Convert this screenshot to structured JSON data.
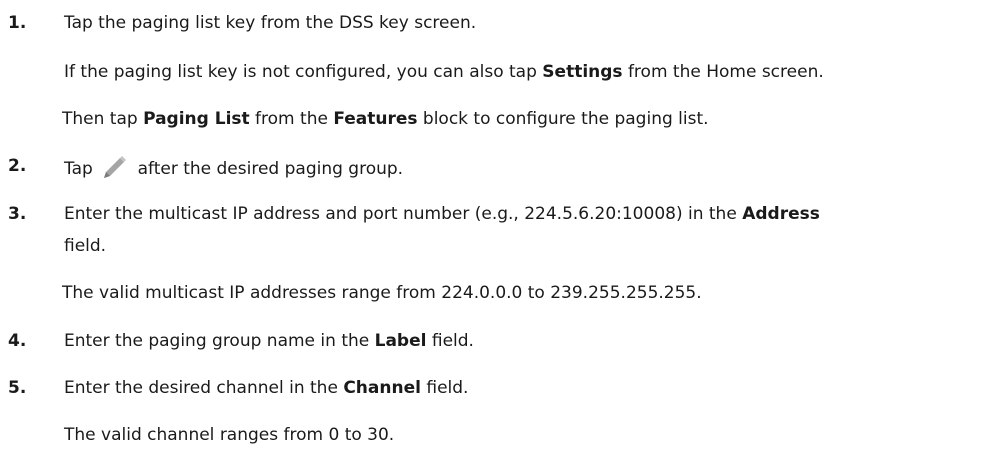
{
  "steps": [
    {
      "number": "1.",
      "text": "Tap the paging list key from the DSS key screen.",
      "note1": {
        "a": "If the paging list key is not configured, you can also tap ",
        "b": "Settings",
        "c": " from the Home screen."
      },
      "note2": {
        "a": "Then tap ",
        "b": "Paging List",
        "c": " from the ",
        "d": "Features",
        "e": " block to configure the paging list."
      }
    },
    {
      "number": "2.",
      "a": "Tap ",
      "icon": "pencil-icon",
      "b": " after the desired paging group."
    },
    {
      "number": "3.",
      "a": "Enter the multicast IP address and port number (e.g., 224.5.6.20:10008) in the ",
      "b": "Address",
      "c": "field.",
      "note": "The valid multicast IP addresses range from 224.0.0.0 to 239.255.255.255."
    },
    {
      "number": "4.",
      "a": "Enter the paging group name in the ",
      "b": "Label",
      "c": " field."
    },
    {
      "number": "5.",
      "a": "Enter the desired channel in the ",
      "b": "Channel",
      "c": " field.",
      "note": "The valid channel ranges from 0 to 30."
    }
  ],
  "colors": {
    "text": "#1a1a1a",
    "pencil": "#9a9a9a"
  }
}
